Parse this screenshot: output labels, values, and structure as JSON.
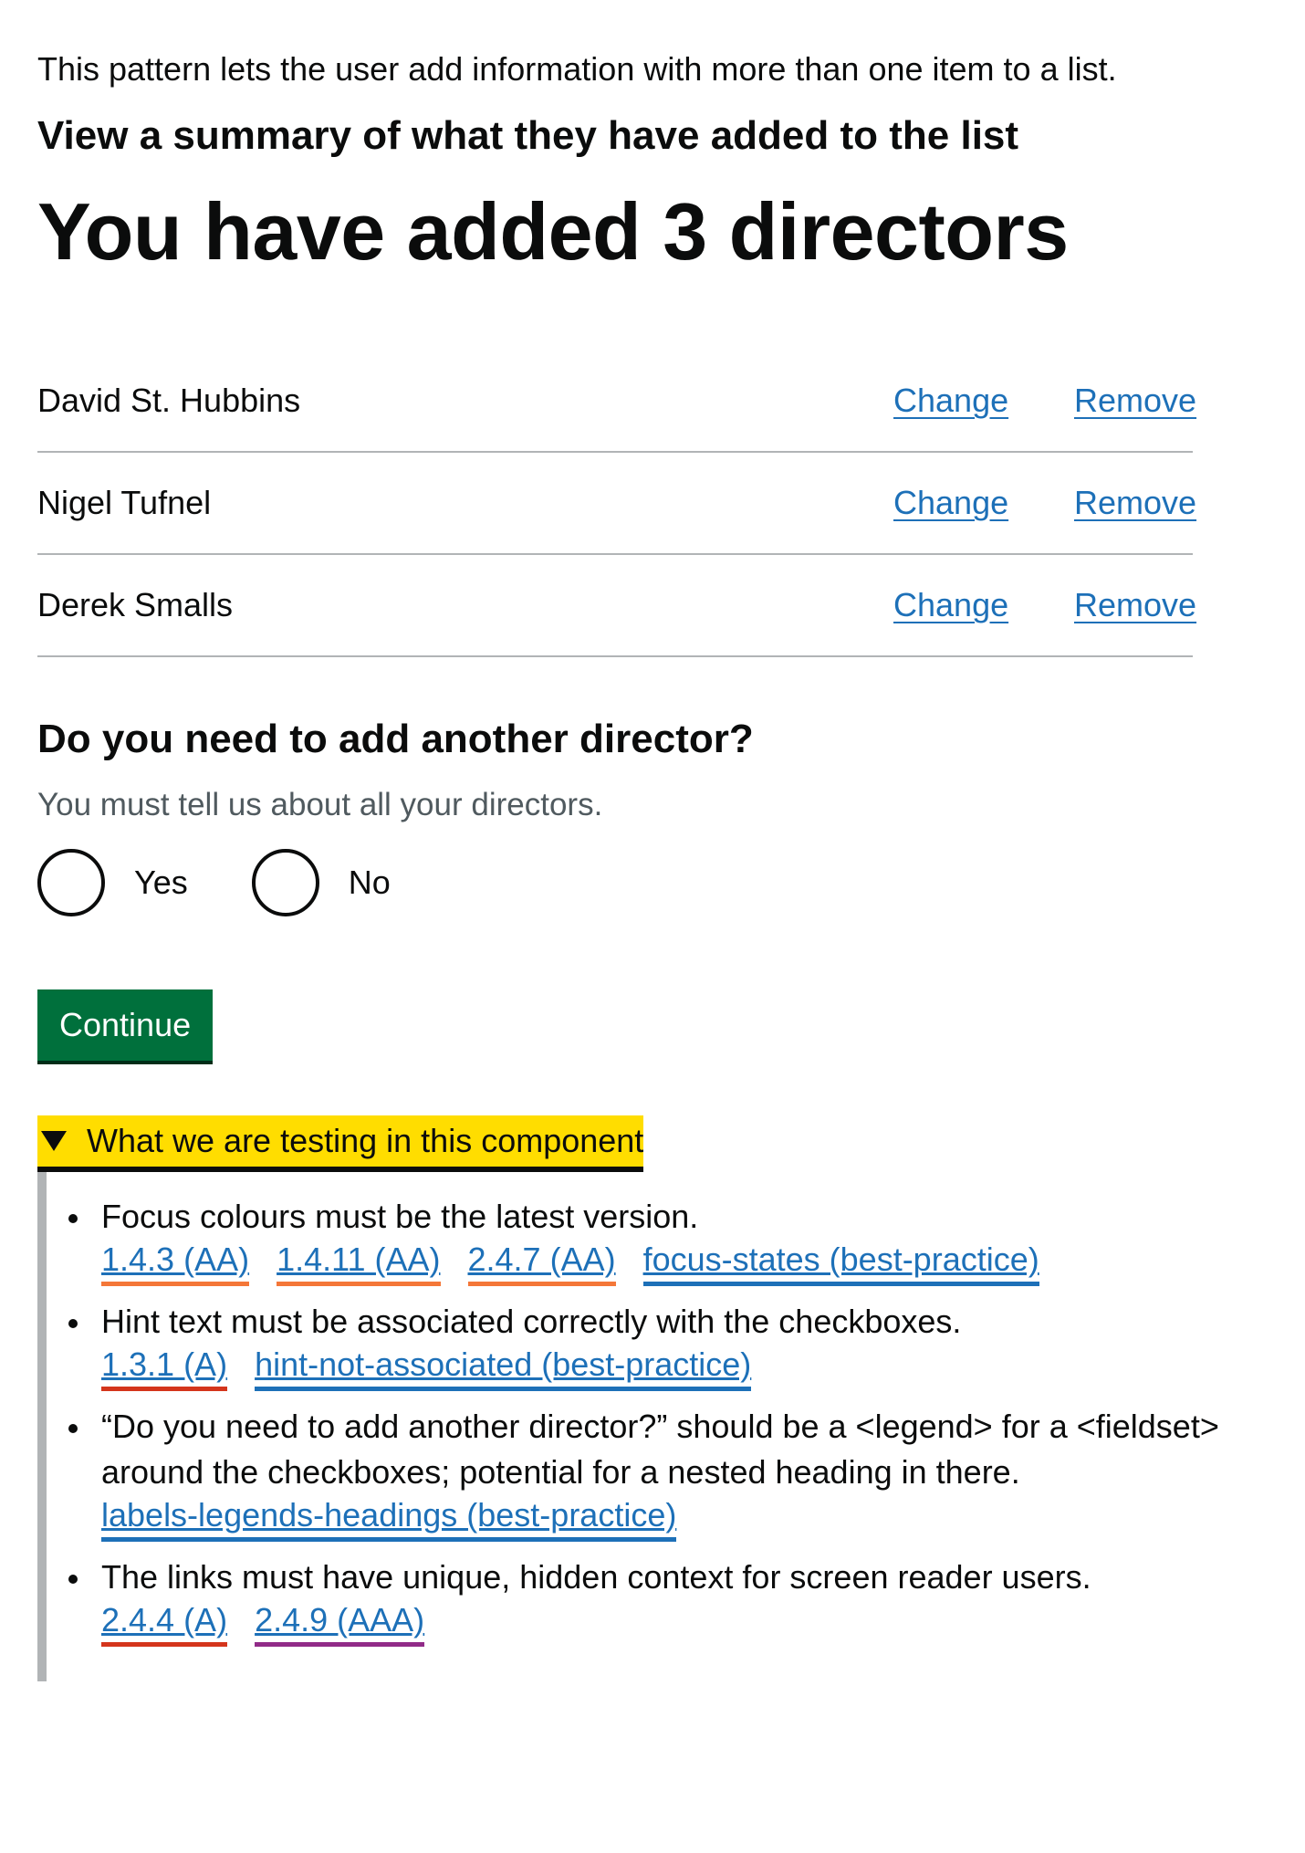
{
  "intro": "This pattern lets the user add information with more than one item to a list.",
  "subheading": "View a summary of what they have added to the list",
  "title": "You have added 3 directors",
  "directors": [
    {
      "name": "David St. Hubbins",
      "change": "Change",
      "remove": "Remove"
    },
    {
      "name": "Nigel Tufnel",
      "change": "Change",
      "remove": "Remove"
    },
    {
      "name": "Derek Smalls",
      "change": "Change",
      "remove": "Remove"
    }
  ],
  "question": {
    "legend": "Do you need to add another director?",
    "hint": "You must tell us about all your directors.",
    "options": [
      "Yes",
      "No"
    ]
  },
  "button": "Continue",
  "details": {
    "summary": "What we are testing in this component",
    "items": [
      {
        "text": "Focus colours must be the latest version.",
        "refs": [
          {
            "label": "1.4.3 (AA)",
            "color": "#f47738"
          },
          {
            "label": "1.4.11 (AA)",
            "color": "#f47738"
          },
          {
            "label": "2.4.7 (AA)",
            "color": "#f47738"
          },
          {
            "label": "focus-states (best-practice)",
            "color": "#1d70b8"
          }
        ]
      },
      {
        "text": "Hint text must be associated correctly with the checkboxes.",
        "refs": [
          {
            "label": "1.3.1 (A)",
            "color": "#d4351c"
          },
          {
            "label": "hint-not-associated (best-practice)",
            "color": "#1d70b8"
          }
        ]
      },
      {
        "text": "“Do you need to add another director?” should be a <legend> for a <fieldset> around the checkboxes; potential for a nested heading in there.",
        "refs": [
          {
            "label": "labels-legends-headings (best-practice)",
            "color": "#1d70b8"
          }
        ]
      },
      {
        "text": "The links must have unique, hidden context for screen reader users.",
        "refs": [
          {
            "label": "2.4.4 (A)",
            "color": "#d4351c"
          },
          {
            "label": "2.4.9 (AAA)",
            "color": "#912b88"
          }
        ]
      }
    ]
  }
}
